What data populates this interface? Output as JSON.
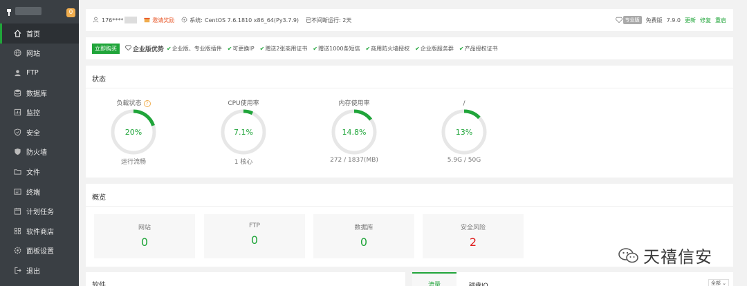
{
  "sidebar": {
    "badge": "0",
    "items": [
      {
        "label": "首页",
        "icon": "home-icon",
        "active": true
      },
      {
        "label": "网站",
        "icon": "globe-icon"
      },
      {
        "label": "FTP",
        "icon": "ftp-user-icon"
      },
      {
        "label": "数据库",
        "icon": "database-icon"
      },
      {
        "label": "监控",
        "icon": "monitor-icon"
      },
      {
        "label": "安全",
        "icon": "shield-icon"
      },
      {
        "label": "防火墙",
        "icon": "firewall-icon"
      },
      {
        "label": "文件",
        "icon": "folder-icon"
      },
      {
        "label": "终端",
        "icon": "terminal-icon"
      },
      {
        "label": "计划任务",
        "icon": "calendar-icon"
      },
      {
        "label": "软件商店",
        "icon": "grid-icon"
      },
      {
        "label": "面板设置",
        "icon": "gear-icon"
      },
      {
        "label": "退出",
        "icon": "logout-icon"
      }
    ]
  },
  "topbar": {
    "user": "176****",
    "invite": "邀请奖励",
    "system_label": "系统:",
    "system_value": "CentOS 7.6.1810 x86_64(Py3.7.9)",
    "uptime": "已不间断运行: 2天",
    "pro_badge": "专业版",
    "edition": "免费版",
    "version": "7.9.0",
    "update": "更新",
    "repair": "修复",
    "restart": "重启"
  },
  "advantages": {
    "buy": "立即购买",
    "title": "企业版优势",
    "items": [
      "企业版、专业版插件",
      "可更换IP",
      "赠送2张商用证书",
      "赠送1000条短信",
      "商用防火墙授权",
      "企业版服务群",
      "产品授权证书"
    ]
  },
  "status": {
    "title": "状态",
    "gauges": [
      {
        "title": "负载状态",
        "value": "20%",
        "percent": 20,
        "bottom": "运行流畅",
        "help": "?"
      },
      {
        "title": "CPU使用率",
        "value": "7.1%",
        "percent": 7.1,
        "bottom": "1 核心"
      },
      {
        "title": "内存使用率",
        "value": "14.8%",
        "percent": 14.8,
        "bottom": "272 / 1837(MB)"
      },
      {
        "title": "/",
        "value": "13%",
        "percent": 13,
        "bottom": "5.9G / 50G"
      }
    ]
  },
  "overview": {
    "title": "概览",
    "items": [
      {
        "label": "网站",
        "value": "0"
      },
      {
        "label": "FTP",
        "value": "0"
      },
      {
        "label": "数据库",
        "value": "0"
      },
      {
        "label": "安全风险",
        "value": "2"
      }
    ]
  },
  "software": {
    "title": "软件"
  },
  "traffic": {
    "tab_flow": "流量",
    "tab_disk": "磁盘IO",
    "select": "全部"
  },
  "watermark": {
    "text": "天禧信安"
  },
  "colors": {
    "accent": "#20a53a",
    "sidebar": "#3a3f44",
    "danger": "#e02020"
  }
}
